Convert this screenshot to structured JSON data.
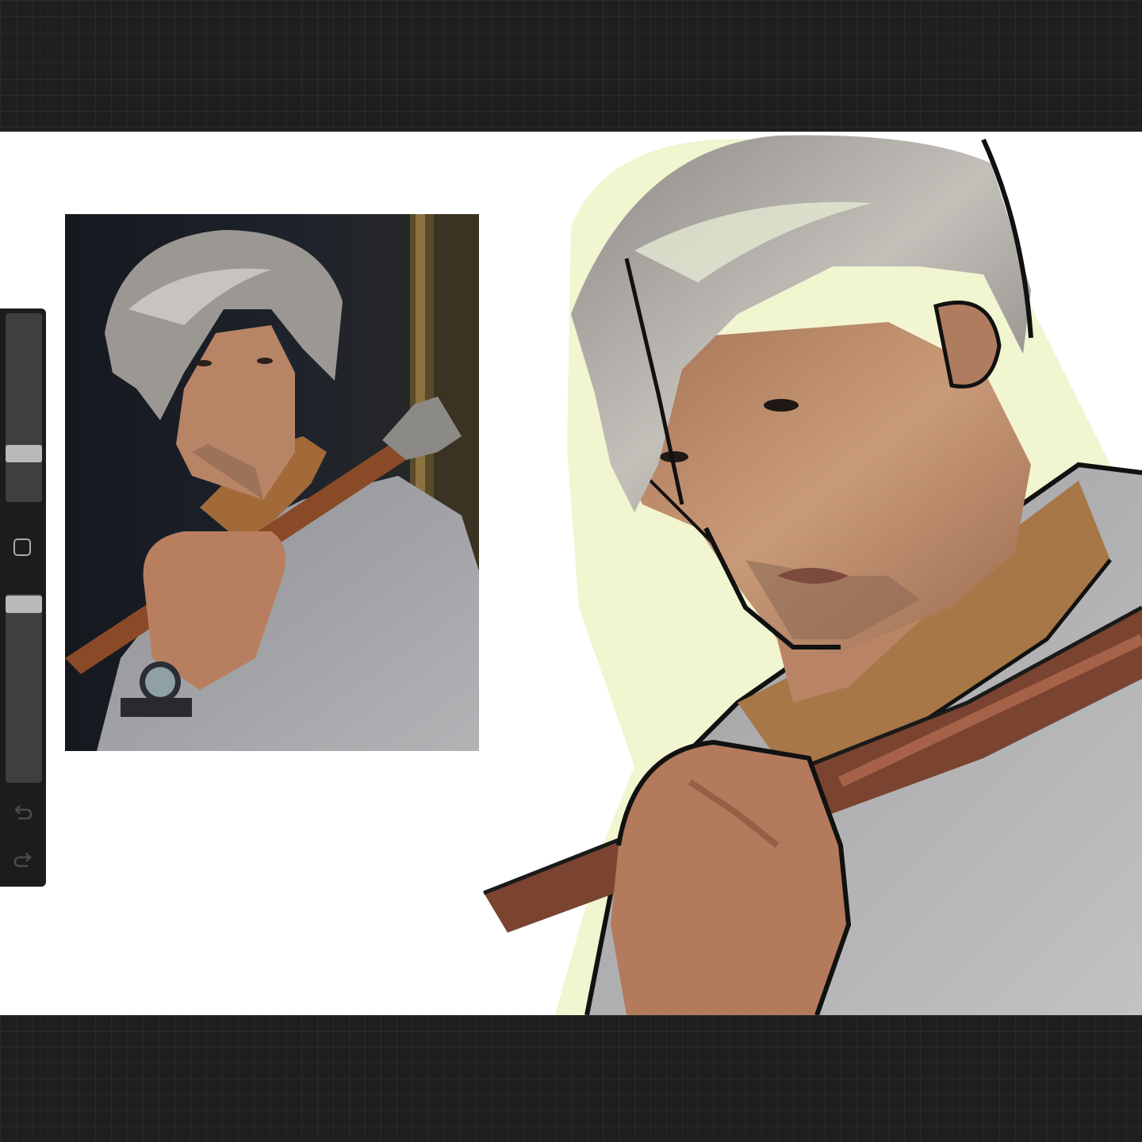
{
  "app": {
    "canvas_background": "#ffffff",
    "workspace_background": "#1f1f21"
  },
  "sidebar": {
    "brush_size": {
      "level": 0.75
    },
    "opacity": {
      "level": 0.02
    },
    "modifier_button": "square-icon",
    "undo_icon": "undo-icon",
    "redo_icon": "redo-icon"
  },
  "canvas": {
    "reference_photo": "reference-photo",
    "painting": "portrait-painting"
  },
  "colors": {
    "hair": "#a9a7a3",
    "skin": "#c08a66",
    "jacket": "#a3a3a6",
    "cane": "#7a4430",
    "outline": "#111111",
    "glow": "#eef3c8"
  }
}
